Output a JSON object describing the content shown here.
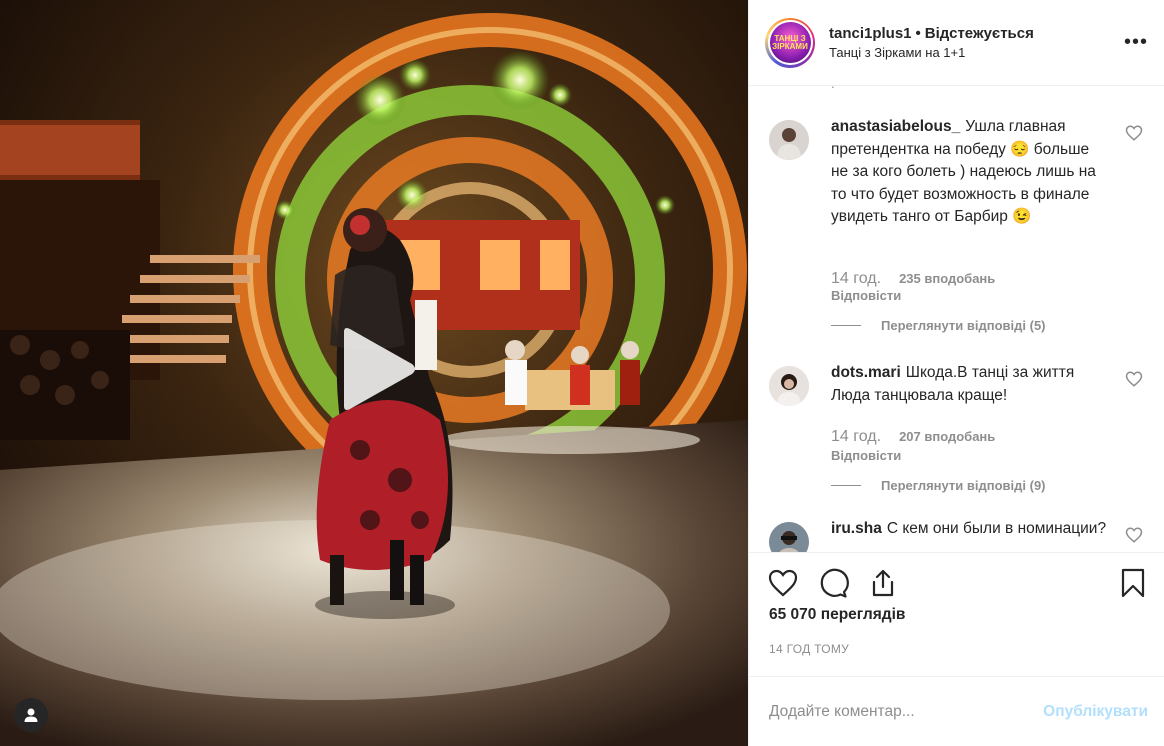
{
  "post": {
    "username": "tanci1plus1",
    "follow_state": "Відстежується",
    "subtitle": "Танці з Зірками на 1+1",
    "avatar_text": "ТАНЦІ З ЗІРКАМИ",
    "more_glyph": "•••"
  },
  "comments": [
    {
      "username": "anastasiabelous_",
      "text": "Ушла главная претендентка на победу 😔 больше не за кого болеть ) надеюсь лишь на то что будет возможность в финале увидеть танго от Барбир 😉",
      "time": "14 год.",
      "likes": "235 вподобань",
      "reply": "Відповісти",
      "view_replies": "Переглянути відповіді (5)"
    },
    {
      "username": "dots.mari",
      "text": "Шкода.В танці за життя Люда танцювала краще!",
      "time": "14 год.",
      "likes": "207 вподобань",
      "reply": "Відповісти",
      "view_replies": "Переглянути відповіді (9)"
    },
    {
      "username": "iru.sha",
      "text": "С кем они были в номинации?"
    }
  ],
  "stats": {
    "views": "65 070 переглядів",
    "time_ago": "14 ГОД ТОМУ"
  },
  "composer": {
    "placeholder": "Додайте коментар...",
    "publish_label": "Опублікувати"
  },
  "colors": {
    "accent_blue_disabled": "#b2dffc",
    "muted": "#8e8e8e",
    "text": "#262626",
    "divider": "#efefef"
  },
  "icons": [
    "play-icon",
    "user-tag-icon",
    "more-options-icon",
    "heart-icon",
    "comment-icon",
    "share-icon",
    "bookmark-icon"
  ]
}
